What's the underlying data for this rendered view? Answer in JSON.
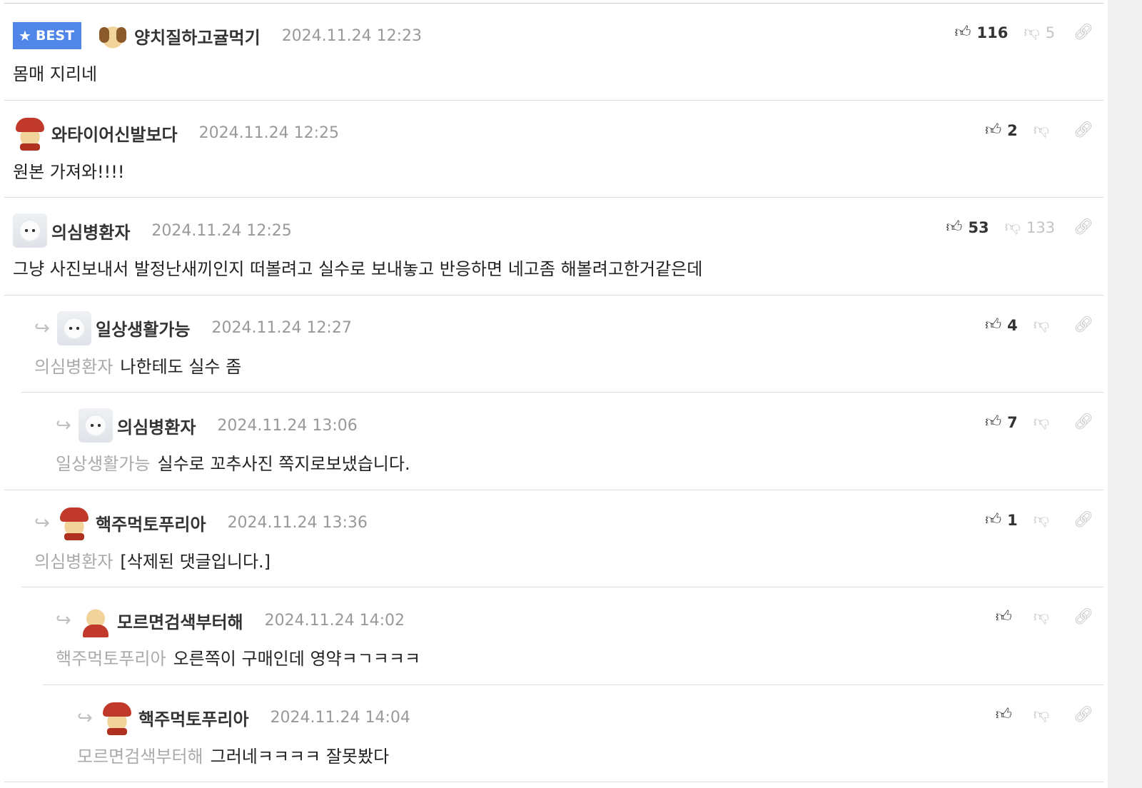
{
  "best_label": "BEST",
  "comments": [
    {
      "nick": "양치질하고귤먹기",
      "date": "2024.11.24 12:23",
      "text": "몸매 지리네",
      "mention": "",
      "up": "116",
      "down": "5",
      "avatar": "dog",
      "best": true,
      "depth": 0
    },
    {
      "nick": "와타이어신발보다",
      "date": "2024.11.24 12:25",
      "text": "원본 가져와!!!!",
      "mention": "",
      "up": "2",
      "down": "",
      "avatar": "red",
      "best": false,
      "depth": 0
    },
    {
      "nick": "의심병환자",
      "date": "2024.11.24 12:25",
      "text": "그냥 사진보내서 발정난새끼인지 떠볼려고 실수로 보내놓고 반응하면 네고좀 해볼려고한거같은데",
      "mention": "",
      "up": "53",
      "down": "133",
      "avatar": "white",
      "best": false,
      "depth": 0
    },
    {
      "nick": "일상생활가능",
      "date": "2024.11.24 12:27",
      "text": "나한테도 실수 좀",
      "mention": "의심병환자",
      "up": "4",
      "down": "",
      "avatar": "white",
      "best": false,
      "depth": 1
    },
    {
      "nick": "의심병환자",
      "date": "2024.11.24 13:06",
      "text": "실수로 꼬추사진 쪽지로보냈습니다.",
      "mention": "일상생활가능",
      "up": "7",
      "down": "",
      "avatar": "white",
      "best": false,
      "depth": 2
    },
    {
      "nick": "핵주먹토푸리아",
      "date": "2024.11.24 13:36",
      "text": "[삭제된 댓글입니다.]",
      "mention": "의심병환자",
      "up": "1",
      "down": "",
      "avatar": "red",
      "best": false,
      "depth": 1
    },
    {
      "nick": "모르면검색부터해",
      "date": "2024.11.24 14:02",
      "text": "오른쪽이 구매인데 영약ㅋㄱㅋㅋㅋ",
      "mention": "핵주먹토푸리아",
      "up": "",
      "down": "",
      "avatar": "santa",
      "best": false,
      "depth": 2
    },
    {
      "nick": "핵주먹토푸리아",
      "date": "2024.11.24 14:04",
      "text": "그러네ㅋㅋㅋㅋ 잘못봤다",
      "mention": "모르면검색부터해",
      "up": "",
      "down": "",
      "avatar": "red",
      "best": false,
      "depth": 3
    }
  ],
  "icons": {
    "like": "thumbs-up-icon",
    "dislike": "thumbs-down-icon",
    "link": "link-icon",
    "reply": "reply-arrow-icon",
    "best": "star-icon"
  }
}
